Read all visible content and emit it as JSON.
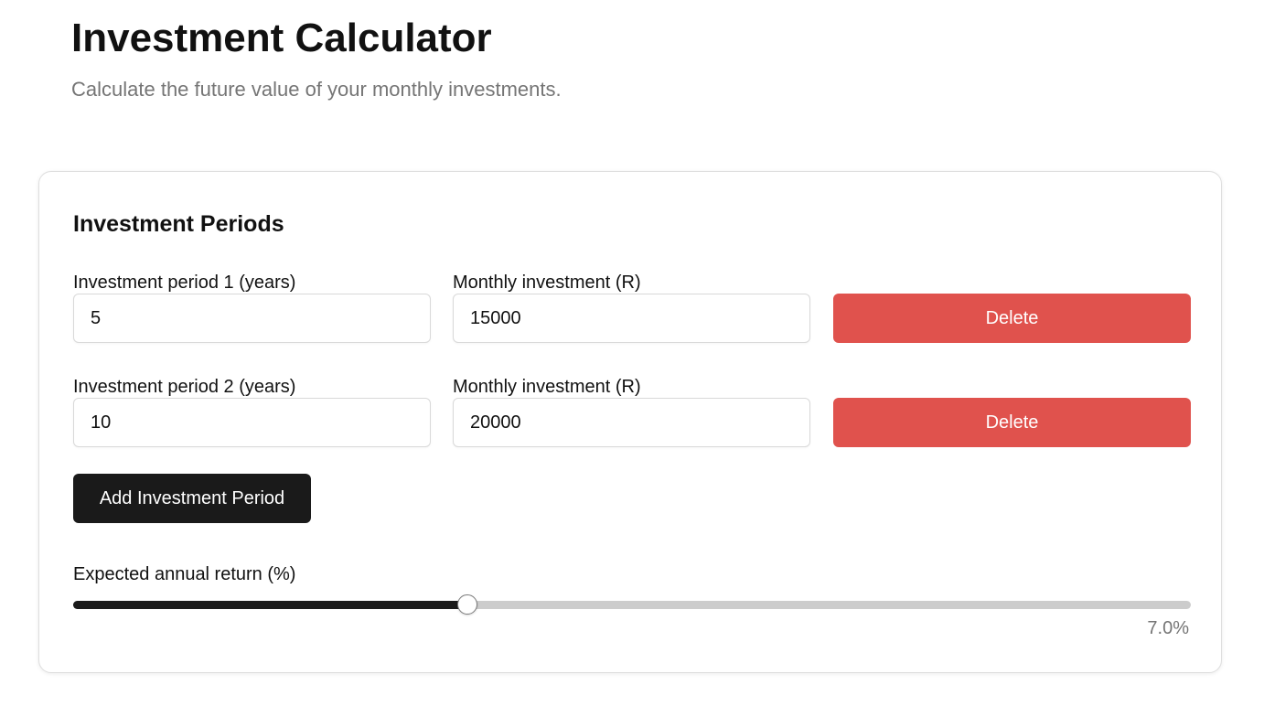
{
  "header": {
    "title": "Investment Calculator",
    "subtitle": "Calculate the future value of your monthly investments."
  },
  "card": {
    "heading": "Investment Periods",
    "periods": [
      {
        "period_label": "Investment period 1 (years)",
        "period_value": "5",
        "investment_label": "Monthly investment (R)",
        "investment_value": "15000",
        "delete_label": "Delete"
      },
      {
        "period_label": "Investment period 2 (years)",
        "period_value": "10",
        "investment_label": "Monthly investment (R)",
        "investment_value": "20000",
        "delete_label": "Delete"
      }
    ],
    "add_label": "Add Investment Period",
    "return": {
      "label": "Expected annual return (%)",
      "value_text": "7.0%",
      "slider_level_percent": 35.3
    }
  },
  "colors": {
    "delete_button": "#e0524d",
    "primary_button": "#1a1a1a",
    "slider_fill": "#1a1a1a",
    "slider_track": "#cccccc",
    "muted_text": "#757575"
  }
}
